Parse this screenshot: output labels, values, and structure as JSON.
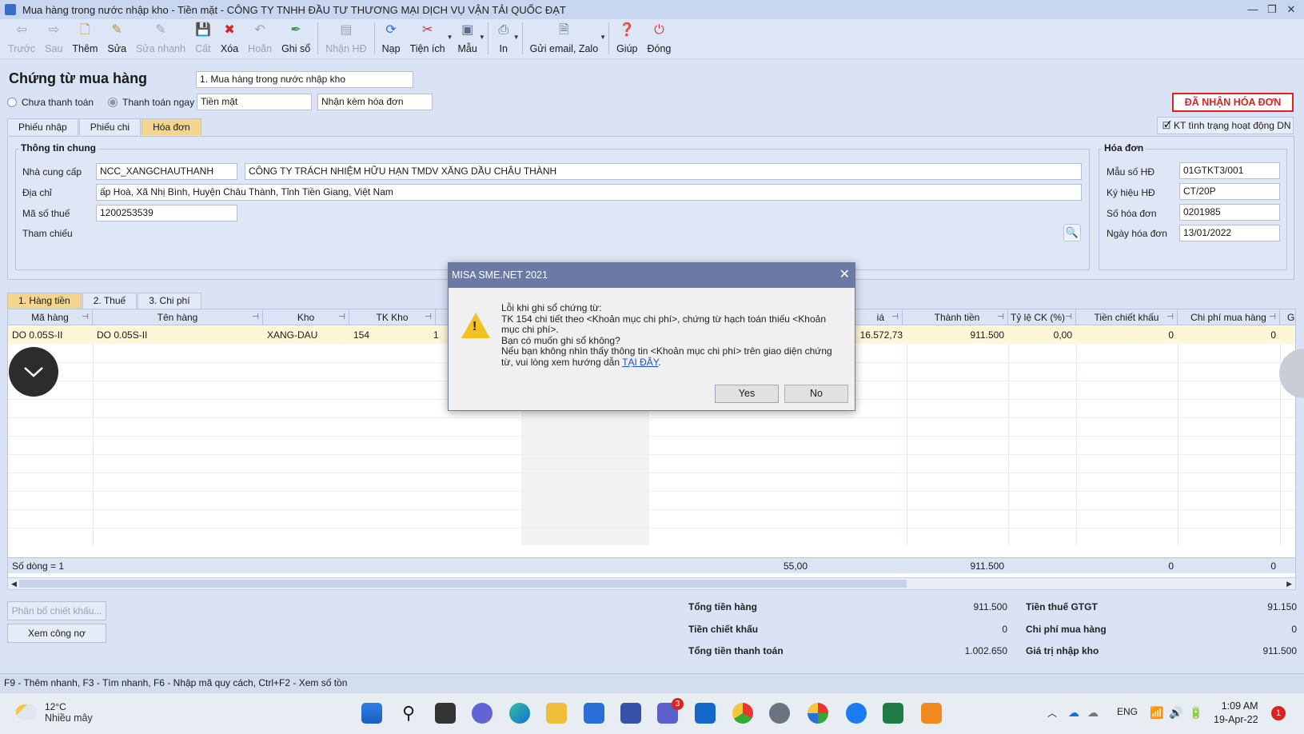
{
  "window": {
    "title": "Mua hàng trong nước nhập kho - Tiền mặt - CÔNG TY TNHH ĐẦU TƯ THƯƠNG MẠI DỊCH VỤ VẬN TẢI QUỐC ĐẠT",
    "controls": [
      "—",
      "❐",
      "✕"
    ]
  },
  "toolbar": {
    "back": "Trước",
    "next": "Sau",
    "add": "Thêm",
    "edit": "Sửa",
    "quick_edit": "Sửa nhanh",
    "save": "Cất",
    "delete": "Xóa",
    "undo": "Hoãn",
    "post": "Ghi sổ",
    "receive_invoice": "Nhận HĐ",
    "reload": "Nạp",
    "utilities": "Tiện ích",
    "template": "Mẫu",
    "print": "In",
    "send_email": "Gửi email, Zalo",
    "help": "Giúp",
    "close": "Đóng"
  },
  "header": {
    "title": "Chứng từ mua hàng",
    "voucher_type": "1. Mua hàng trong nước nhập kho",
    "unpaid_label": "Chưa thanh toán",
    "paid_label": "Thanh toán ngay",
    "payment_method": "Tiền mặt",
    "invoice_mode": "Nhận kèm hóa đơn",
    "received_button": "ĐÃ NHẬN HÓA ĐƠN",
    "kt_button": "KT tình trạng hoạt động DN"
  },
  "tabs": {
    "receipt": "Phiếu nhập",
    "payment": "Phiếu chi",
    "invoice": "Hóa đơn"
  },
  "general": {
    "section_title": "Thông tin chung",
    "supplier_label": "Nhà cung cấp",
    "supplier_code": "NCC_XANGCHAUTHANH",
    "supplier_name": "CÔNG TY TRÁCH NHIỆM HỮU HẠN TMDV XĂNG DẦU CHÂU THÀNH",
    "address_label": "Địa chỉ",
    "address": "ấp Hoà, Xã Nhị Bình, Huyện Châu Thành, Tỉnh Tiền Giang, Việt Nam",
    "tax_label": "Mã số thuế",
    "tax_code": "1200253539",
    "ref_label": "Tham chiếu"
  },
  "invoice": {
    "section_title": "Hóa đơn",
    "form_label": "Mẫu số HĐ",
    "form_no": "01GTKT3/001",
    "symbol_label": "Ký hiệu HĐ",
    "symbol": "CT/20P",
    "number_label": "Số hóa đơn",
    "number": "0201985",
    "date_label": "Ngày hóa đơn",
    "date": "13/01/2022"
  },
  "detail_tabs": {
    "goods": "1. Hàng tiền",
    "tax": "2. Thuế",
    "cost": "3. Chi phí"
  },
  "grid": {
    "headers": {
      "code": "Mã hàng",
      "name": "Tên hàng",
      "warehouse": "Kho",
      "account": "TK Kho",
      "price": "iá",
      "amount": "Thành tiền",
      "discount_rate": "Tỷ lệ CK (%)",
      "discount": "Tiền chiết khấu",
      "purchase_cost": "Chi phí mua hàng",
      "extra": "Gi"
    },
    "row": {
      "code": "DO 0.05S-II",
      "name": "DO 0.05S-II",
      "warehouse": "XANG-DAU",
      "account": "154",
      "partial": "1",
      "price": "16.572,73",
      "amount": "911.500",
      "discount_rate": "0,00",
      "discount": "0",
      "purchase_cost": "0"
    },
    "footer": {
      "row_count": "Số dòng = 1",
      "qty_total": "55,00",
      "amount_total": "911.500",
      "discount_total": "0",
      "cost_total": "0"
    }
  },
  "buttons": {
    "allocate": "Phân bổ chiết khấu...",
    "view_debt": "Xem công nợ"
  },
  "summary": {
    "total_goods_label": "Tổng tiền hàng",
    "total_goods": "911.500",
    "discount_label": "Tiền chiết khấu",
    "discount": "0",
    "total_pay_label": "Tổng tiền thanh toán",
    "total_pay": "1.002.650",
    "vat_label": "Tiền thuế GTGT",
    "vat": "91.150",
    "cost_label": "Chi phí mua hàng",
    "cost": "0",
    "stock_value_label": "Giá trị nhập kho",
    "stock_value": "911.500"
  },
  "statusbar": "F9 - Thêm nhanh, F3 - Tìm nhanh, F6 - Nhập mã quy cách, Ctrl+F2 - Xem số tồn",
  "dialog": {
    "title": "MISA SME.NET 2021",
    "line1": "Lỗi khi ghi sổ chứng từ:",
    "line2": "TK 154 chi tiết theo <Khoản mục chi phí>, chứng từ hạch toán thiếu <Khoản mục chi phí>.",
    "line3": "Bạn có muốn ghi sổ không?",
    "line4": "Nếu bạn không nhìn thấy thông tin <Khoản mục chi phí> trên giao diện chứng từ, vui lòng xem hướng dẫn",
    "link": "TẠI ĐÂY",
    "yes": "Yes",
    "no": "No"
  },
  "taskbar": {
    "temp": "12°C",
    "weather": "Nhiều mây",
    "teams_badge": "3",
    "lang": "ENG",
    "time": "1:09 AM",
    "date": "19-Apr-22",
    "notif": "1"
  }
}
